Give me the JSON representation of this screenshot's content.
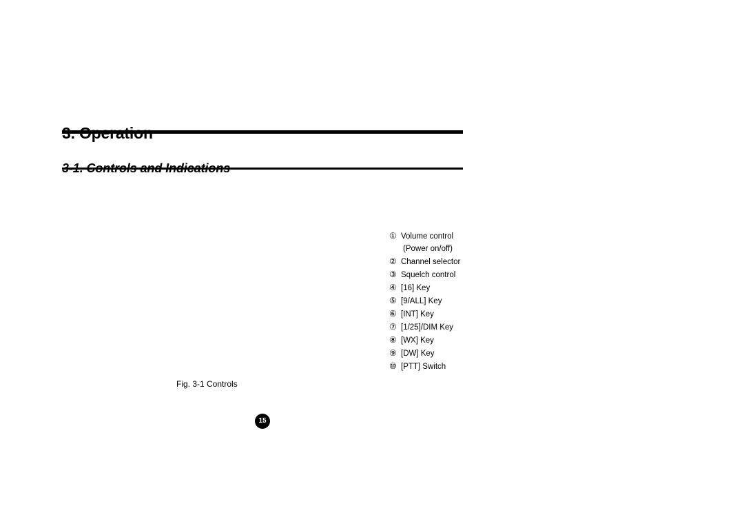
{
  "page": {
    "background_color": "#ffffff",
    "text_color": "#000000"
  },
  "section": {
    "heading": "3. Operation",
    "subheading": "3-1. Controls and Indications"
  },
  "figure": {
    "caption": "Fig. 3-1 Controls"
  },
  "legend": {
    "items": [
      {
        "marker": "①",
        "label": "Volume control",
        "subline": "(Power on/off)"
      },
      {
        "marker": "②",
        "label": "Channel selector"
      },
      {
        "marker": "③",
        "label": "Squelch control"
      },
      {
        "marker": "④",
        "label": "[16] Key"
      },
      {
        "marker": "⑤",
        "label": "[9/ALL] Key"
      },
      {
        "marker": "⑥",
        "label": "[INT] Key"
      },
      {
        "marker": "⑦",
        "label": "[1/25]/DIM Key"
      },
      {
        "marker": "⑧",
        "label": "[WX] Key"
      },
      {
        "marker": "⑨",
        "label": "[DW] Key"
      },
      {
        "marker": "⑩",
        "label": "[PTT] Switch"
      }
    ]
  },
  "footer": {
    "page_number": "15"
  }
}
